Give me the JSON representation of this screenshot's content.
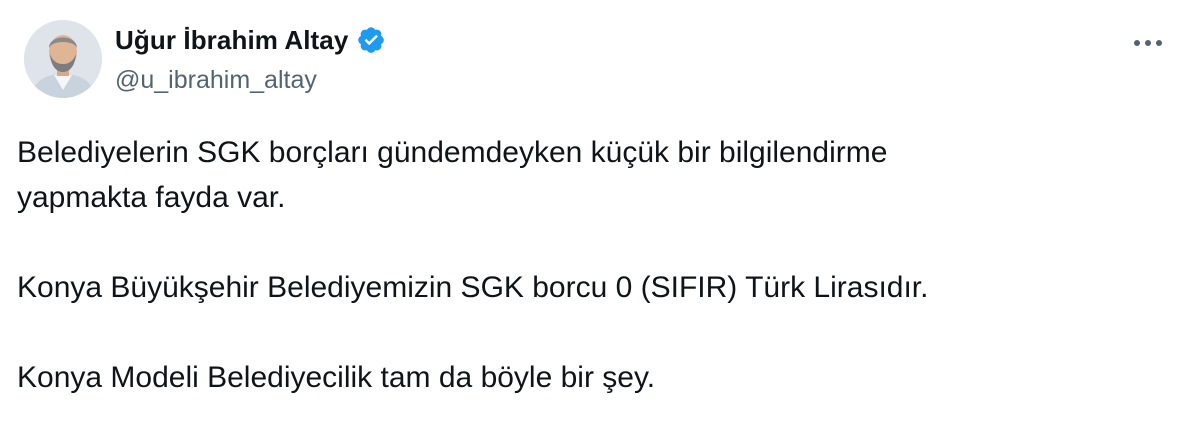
{
  "author": {
    "display_name": "Uğur İbrahim Altay",
    "handle": "@u_ibrahim_altay",
    "verified": true,
    "avatar_icon": "profile-photo"
  },
  "menu_icon": "more-options-icon",
  "tweet": {
    "paragraphs": [
      {
        "lines": [
          "Belediyelerin SGK borçları gündemdeyken küçük bir bilgilendirme",
          "yapmakta fayda var."
        ]
      },
      {
        "lines": [
          "Konya Büyükşehir Belediyemizin SGK borcu 0 (SIFIR) Türk Lirasıdır."
        ]
      },
      {
        "lines": [
          "Konya Modeli Belediyecilik tam da böyle bir şey."
        ]
      }
    ]
  },
  "colors": {
    "text": "#0f1419",
    "secondary": "#536471",
    "verified_badge": "#1d9bf0",
    "background": "#ffffff"
  }
}
